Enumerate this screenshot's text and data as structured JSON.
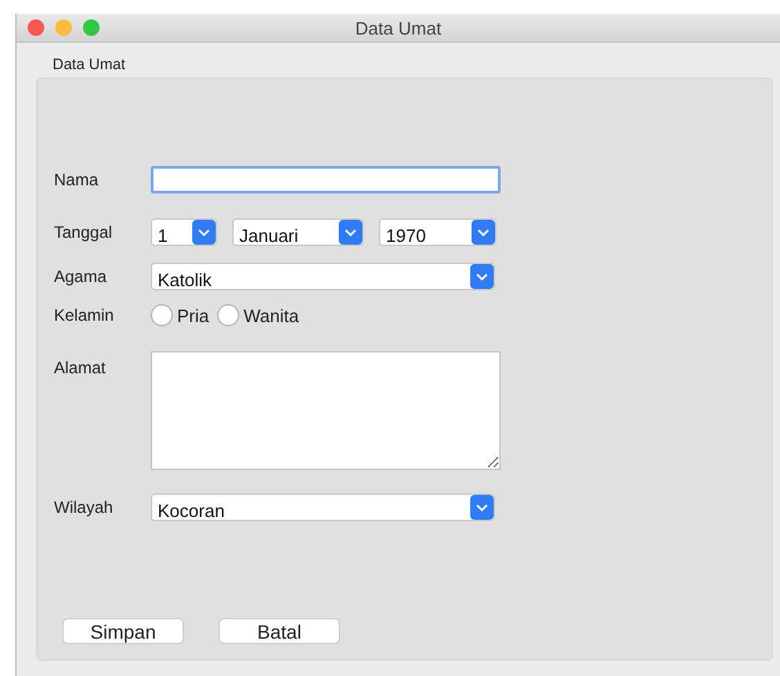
{
  "window": {
    "title": "Data Umat"
  },
  "panel": {
    "title": "Data Umat"
  },
  "fields": [
    {
      "kind": "text",
      "label": "Nama",
      "focused": true
    },
    {
      "kind": "selects",
      "label": "Tanggal",
      "selects": [
        {
          "value": "1"
        },
        {
          "value": "Januari"
        },
        {
          "value": "1970"
        }
      ]
    },
    {
      "kind": "select",
      "label": "Agama",
      "value": "Katolik"
    },
    {
      "kind": "radios",
      "label": "Kelamin",
      "options": [
        {
          "label": "Pria",
          "selected": false
        },
        {
          "label": "Wanita",
          "selected": false
        }
      ]
    },
    {
      "kind": "textarea",
      "label": "Alamat"
    },
    {
      "kind": "select",
      "label": "Wilayah",
      "value": "Kocoran"
    }
  ],
  "buttons": [
    "Simpan",
    "Batal"
  ]
}
